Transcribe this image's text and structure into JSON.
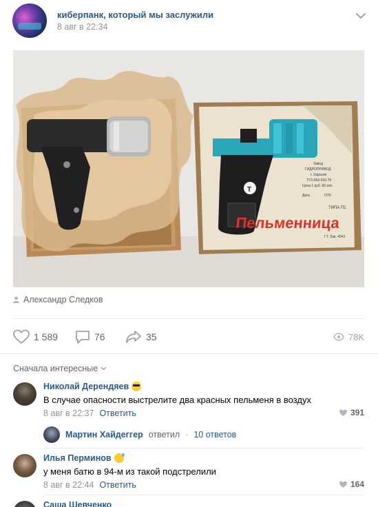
{
  "post": {
    "group_name": "киберпанк, который мы заслужили",
    "date": "8 авг в 22:34",
    "photo": {
      "box_label": "Пельменница",
      "box_small_text": [
        "Завод",
        "ГИДРОПРИВОД",
        "г. Харьков",
        "ТУ2-053-010-76",
        "Цена 1 руб. 60 коп.",
        "Дата",
        "ОТК",
        "ТИПА П1",
        "ГТ. Зав. 4041"
      ]
    },
    "author": "Александр Следков",
    "likes": "1 589",
    "comments": "76",
    "shares": "35",
    "views": "78K"
  },
  "comments_section": {
    "sort_label": "Сначала интересные",
    "items": [
      {
        "name": "Николай Дерендяев",
        "emoji": "cool-face-emoji",
        "text": "В случае опасности выстрелите два красных пельменя в воздух",
        "date": "8 авг в 22:37",
        "reply_label": "Ответить",
        "likes": "391"
      },
      {
        "name": "Илья Перминов",
        "emoji": "sweat-face-emoji",
        "text": "у меня батю в 94-м из такой подстрелили",
        "date": "8 авг в 22:44",
        "reply_label": "Ответить",
        "likes": "164"
      },
      {
        "name": "Саша Шевченко"
      }
    ],
    "thread": {
      "name": "Мартин Хайдеггер",
      "verb": "ответил",
      "separator": "·",
      "count": "10 ответов"
    }
  },
  "icons": {
    "chevron": "chevron-down-icon",
    "author": "person-icon",
    "like": "heart-icon",
    "comment": "speech-bubble-icon",
    "share": "share-arrow-icon",
    "views": "eye-icon",
    "comment_like": "small-heart-icon",
    "sort": "chevron-down-icon"
  },
  "colors": {
    "link": "#2a5885",
    "secondary_text": "#939393",
    "icon_gray": "#99a2ad",
    "separator": "#e7e8ec",
    "box_teal": "#2aa6b8",
    "box_red": "#d9352c"
  }
}
